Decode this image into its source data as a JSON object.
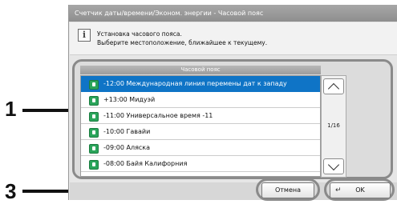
{
  "annotations": [
    {
      "number": "1"
    },
    {
      "number": "3"
    }
  ],
  "window": {
    "title": "Счетчик даты/времени/Эконом. энергии - Часовой пояс"
  },
  "message": {
    "icon": "info-icon",
    "line1": "Установка часового пояса.",
    "line2": "Выберите местоположение, ближайшее к текущему."
  },
  "list": {
    "header": "Часовой пояс",
    "items": [
      {
        "label": "-12:00 Международная линия перемены дат к западу",
        "selected": true
      },
      {
        "label": "+13:00 Мидуэй",
        "selected": false
      },
      {
        "label": "-11:00 Универсальное время -11",
        "selected": false
      },
      {
        "label": "-10:00 Гавайи",
        "selected": false
      },
      {
        "label": "-09:00 Аляска",
        "selected": false
      },
      {
        "label": "-08:00 Байя Калифорния",
        "selected": false
      }
    ],
    "page_indicator": "1/16"
  },
  "buttons": {
    "cancel": "Отмена",
    "ok": "OK"
  },
  "colors": {
    "selected_row": "#0f74c6",
    "titlebar": "#999999",
    "globe_icon": "#2aa45a"
  }
}
